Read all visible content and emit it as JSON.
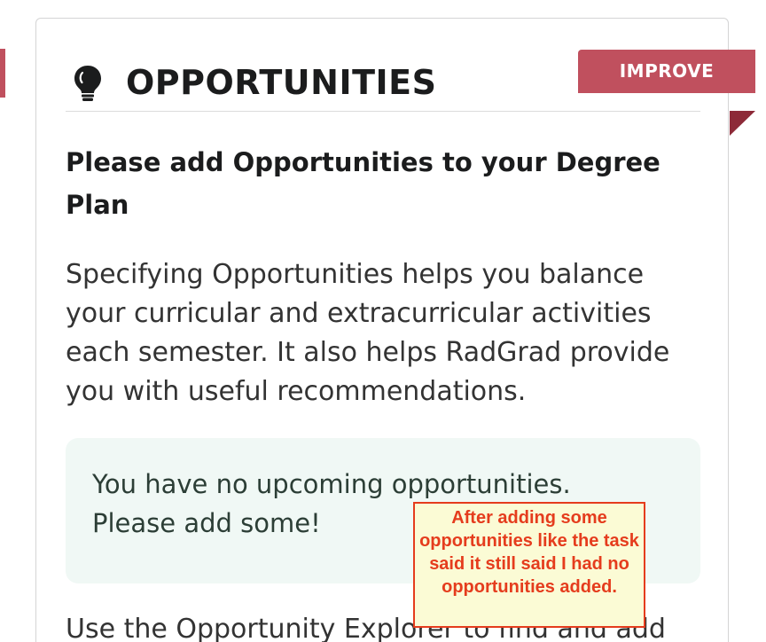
{
  "card": {
    "title": "OPPORTUNITIES",
    "header_icon": "lightbulb-icon",
    "ribbon_label": "IMPROVE",
    "heading": "Please add Opportunities to your Degree Plan",
    "description": "Specifying Opportunities helps you balance your curricular and extracurricular activities each semester. It also helps RadGrad provide you with useful recommendations.",
    "message": "You have no upcoming opportunities. Please add some!",
    "footer_text": "Use the Opportunity Explorer to find and add"
  },
  "annotation": {
    "note_text": "After adding some opportunities like the task said it still said I had no opportunities added."
  },
  "colors": {
    "ribbon": "#c0505e",
    "ribbon_fold": "#8d2a38",
    "message_background": "#f0f8f5",
    "note_border": "#e53c1d",
    "note_background": "#fbfbd5"
  }
}
